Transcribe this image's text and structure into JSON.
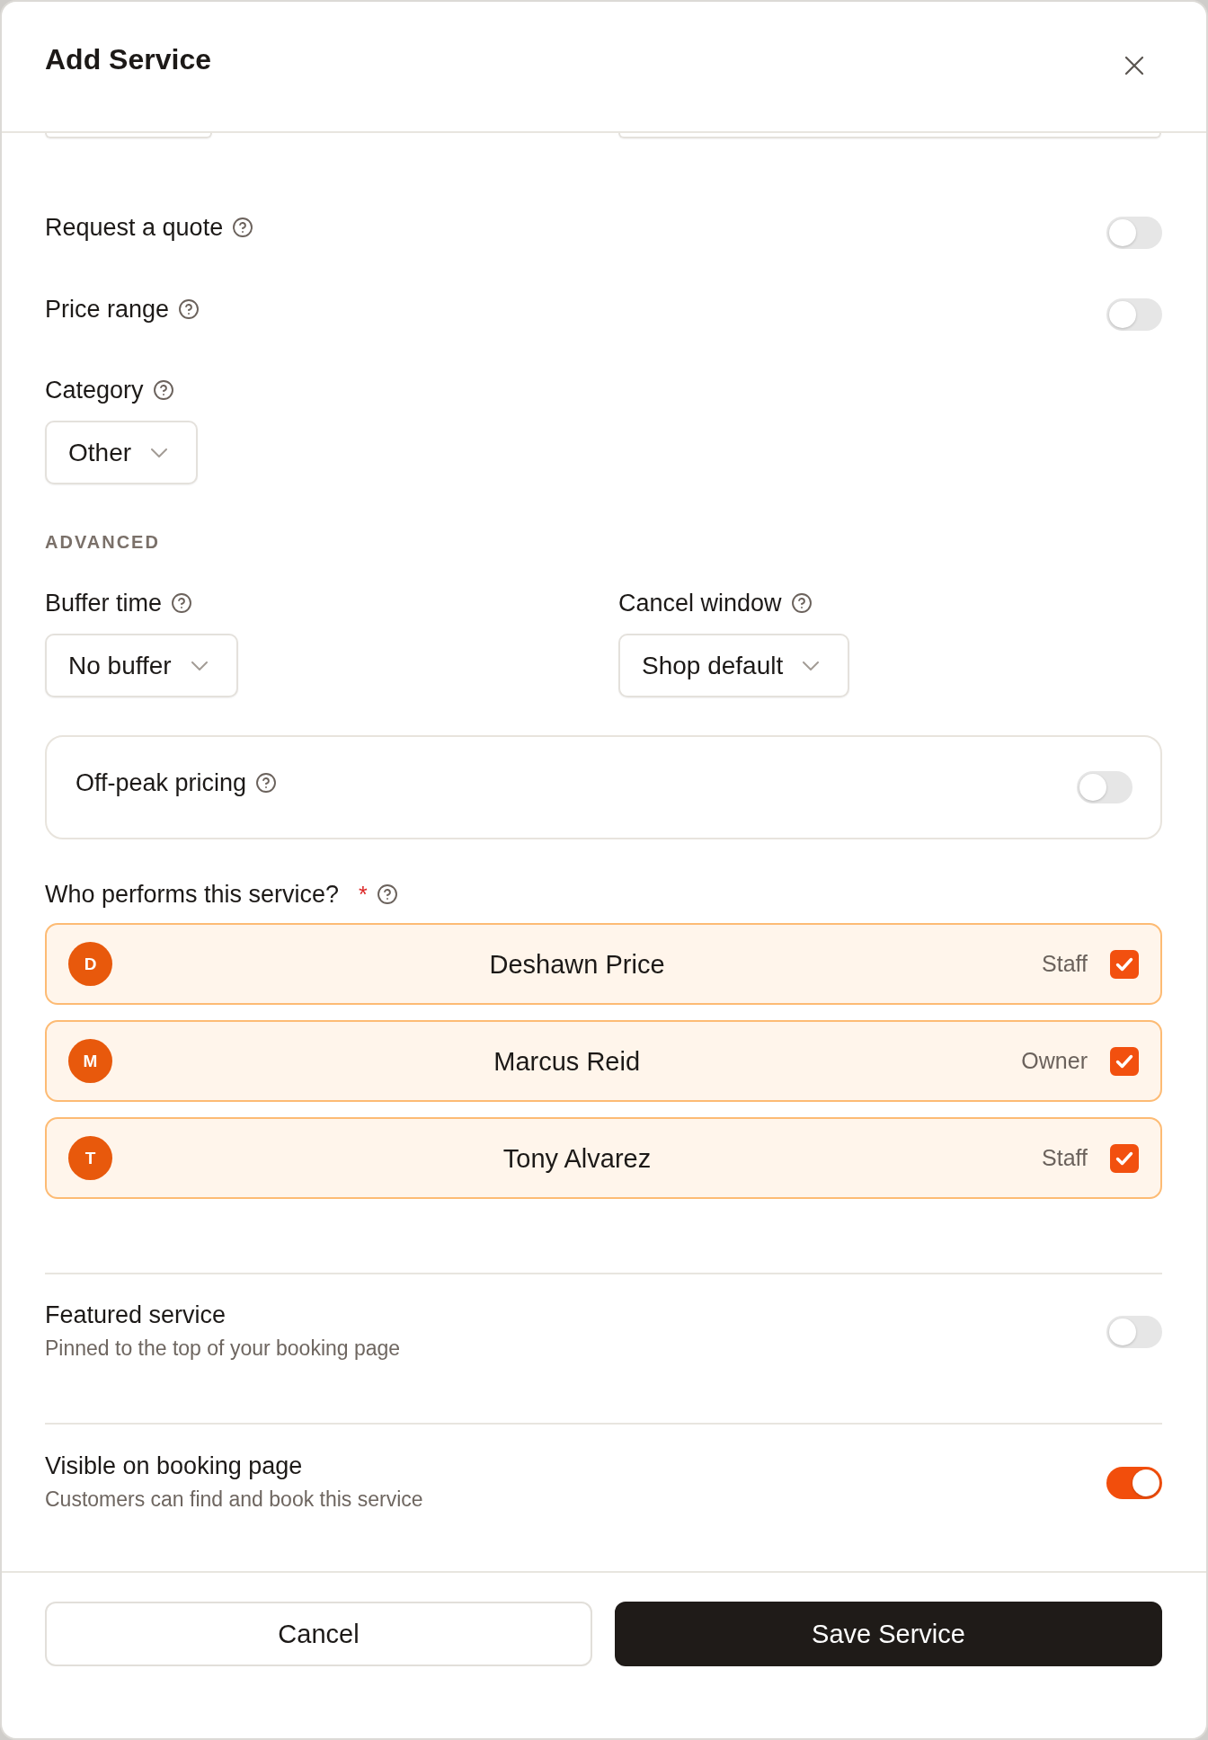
{
  "dialog": {
    "title": "Add Service"
  },
  "toggles": [
    {
      "label": "Request a quote",
      "help": true,
      "on": false
    },
    {
      "label": "Price range",
      "help": true,
      "on": false
    }
  ],
  "category": {
    "label": "Category",
    "help": true,
    "value": "Other"
  },
  "advanced": {
    "heading": "ADVANCED",
    "selects": [
      {
        "label": "Buffer time",
        "help": true,
        "value": "No buffer"
      },
      {
        "label": "Cancel window",
        "help": true,
        "value": "Shop default"
      }
    ],
    "off_peak": {
      "label": "Off-peak pricing",
      "help": true,
      "on": false
    }
  },
  "staff": {
    "label": "Who performs this service?",
    "required_mark": "*",
    "help": true,
    "members": [
      {
        "initial": "D",
        "name": "Deshawn Price",
        "role": "Staff",
        "checked": true
      },
      {
        "initial": "M",
        "name": "Marcus Reid",
        "role": "Owner",
        "checked": true
      },
      {
        "initial": "T",
        "name": "Tony Alvarez",
        "role": "Staff",
        "checked": true
      }
    ]
  },
  "settings": [
    {
      "title": "Featured service",
      "description": "Pinned to the top of your booking page",
      "on": false
    },
    {
      "title": "Visible on booking page",
      "description": "Customers can find and book this service",
      "on": true
    }
  ],
  "footer": {
    "buttons": [
      {
        "label": "Cancel",
        "kind": "secondary"
      },
      {
        "label": "Save Service",
        "kind": "primary"
      }
    ]
  }
}
